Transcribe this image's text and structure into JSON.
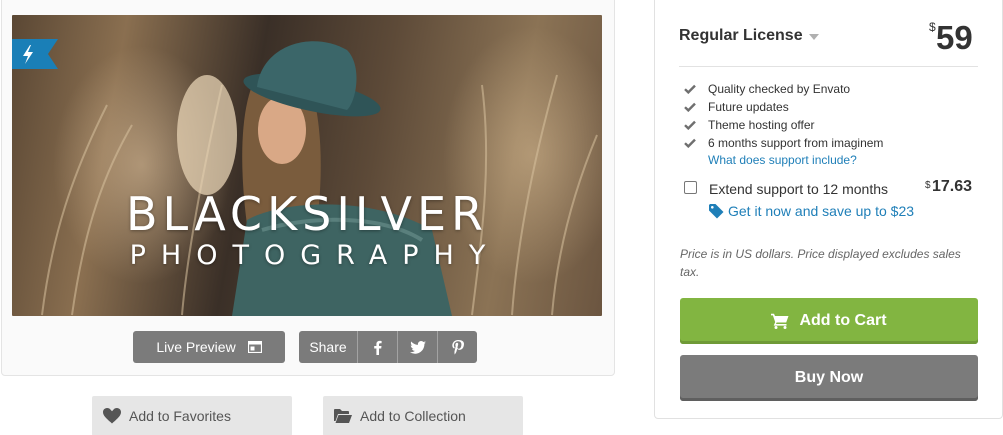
{
  "preview": {
    "title_main": "BLACKSILVER",
    "title_sub": "PHOTOGRAPHY",
    "badge_icon": "lightning-icon",
    "live_preview_label": "Live Preview",
    "share_label": "Share",
    "share_icons": [
      "facebook-icon",
      "twitter-icon",
      "pinterest-icon"
    ]
  },
  "actions": {
    "favorites_label": "Add to Favorites",
    "collection_label": "Add to Collection"
  },
  "license": {
    "name": "Regular License",
    "currency": "$",
    "price": "59",
    "features": [
      "Quality checked by Envato",
      "Future updates",
      "Theme hosting offer",
      "6 months support from imaginem"
    ],
    "support_link": "What does support include?",
    "extend_label": "Extend support to 12 months",
    "extend_currency": "$",
    "extend_price": "17.63",
    "extend_checked": false,
    "save_link": "Get it now and save up to $23",
    "note": "Price is in US dollars. Price displayed excludes sales tax.",
    "add_to_cart_label": "Add to Cart",
    "buy_now_label": "Buy Now"
  },
  "colors": {
    "accent_green": "#82b541",
    "button_gray": "#7b7b7b",
    "link_blue": "#1f7fb8",
    "ribbon_blue": "#1a7fb7"
  }
}
